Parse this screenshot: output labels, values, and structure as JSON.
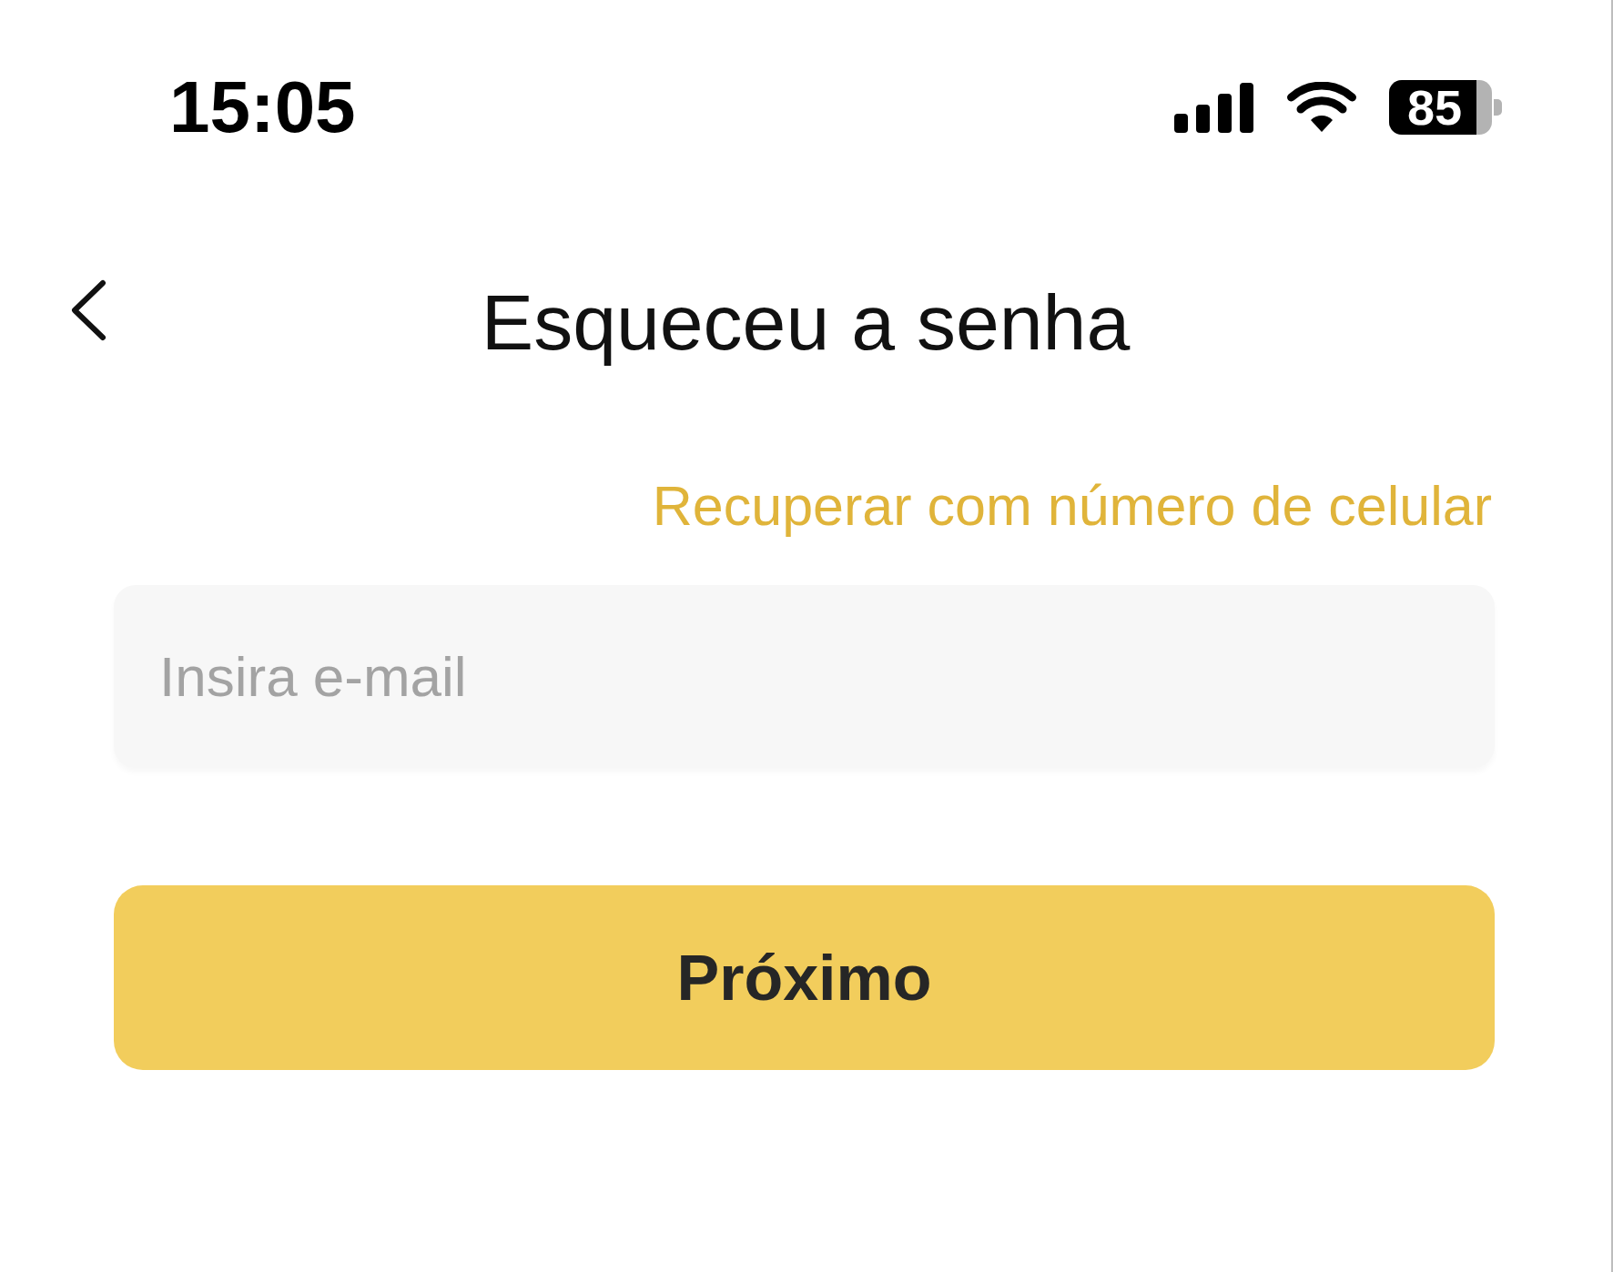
{
  "status_bar": {
    "time": "15:05",
    "battery": "85"
  },
  "header": {
    "title": "Esqueceu a senha"
  },
  "recover_link": "Recuperar com número de celular",
  "email_field": {
    "placeholder": "Insira e-mail"
  },
  "next_button": {
    "label": "Próximo"
  }
}
